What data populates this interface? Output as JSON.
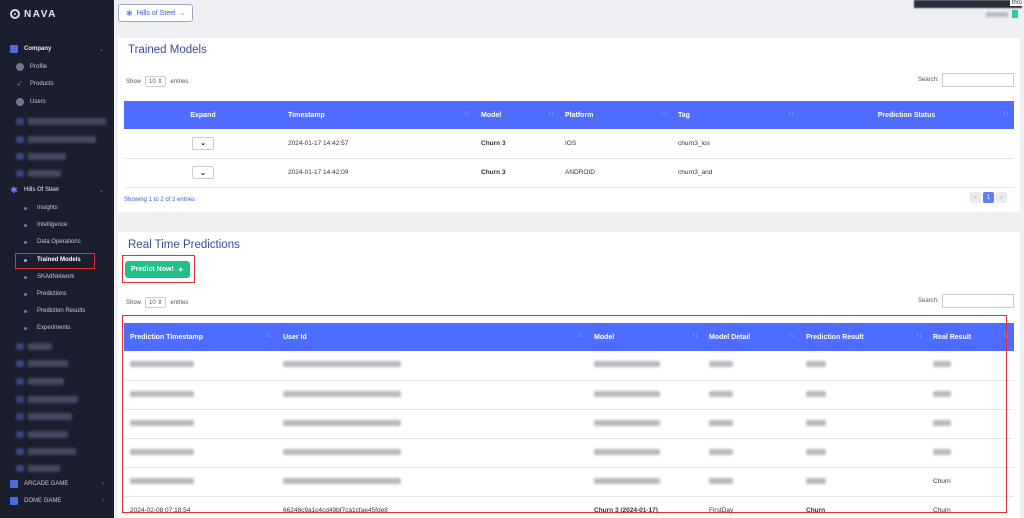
{
  "app": {
    "logo_text": "NAVA"
  },
  "sidebar": {
    "company_label": "Company",
    "profile_label": "Profile",
    "products_label": "Products",
    "users_label": "Users",
    "game_label": "Hills Of Steel",
    "game_items": [
      "Insights",
      "Intelligence",
      "Data Operations",
      "Trained Models",
      "SKAdNetwork",
      "Predictions",
      "Prediction Results",
      "Experiments"
    ],
    "arcade_label": "ARCADE GAME",
    "dome_label": "DOME GAME"
  },
  "topbar": {
    "selected_game": "Hills of Steel",
    "corner_text": "thro"
  },
  "trained_models": {
    "title": "Trained Models",
    "show_label": "Show",
    "entries_value": "10",
    "entries_label": "entries",
    "search_label": "Search:",
    "columns": [
      "Expand",
      "Timestamp",
      "Model",
      "Platform",
      "Tag",
      "Prediction Status"
    ],
    "rows": [
      {
        "timestamp": "2024-01-17 14:42:57",
        "model": "Churn 3",
        "platform": "IOS",
        "tag": "churn3_ios",
        "status": ""
      },
      {
        "timestamp": "2024-01-17 14:42:09",
        "model": "Churn 3",
        "platform": "ANDROID",
        "tag": "churn3_and",
        "status": ""
      }
    ],
    "showing_text": "Showing 1 to 2 of 2 entries",
    "page_current": "1",
    "page_prev": "‹",
    "page_next": "›"
  },
  "predictions": {
    "title": "Real Time Predictions",
    "predict_button": "Predict Now!",
    "show_label": "Show",
    "entries_value": "10",
    "entries_label": "entries",
    "search_label": "Search:",
    "columns": [
      "Prediction Timestamp",
      "User Id",
      "Model",
      "Model Detail",
      "Prediction Result",
      "Real Result"
    ],
    "visible_rows": [
      {
        "real_result": "Churn"
      },
      {
        "timestamp": "2024-02-08 07:18:54",
        "user_id": "66248c9a1c4cd49bf7ca1cfae45fde8",
        "model": "Churn 3 (2024-01-17)",
        "detail": "FirstDay",
        "prediction": "Churn",
        "real_result": "Churn"
      }
    ]
  },
  "colors": {
    "sidebar_bg": "#1b1e2d",
    "table_header": "#4e6cff",
    "accent_green": "#21c08b",
    "highlight_red": "#e03030",
    "title_blue": "#3a4a9c"
  },
  "icons": [
    "logo-mark-icon",
    "building-icon",
    "user-icon",
    "rocket-icon",
    "users-icon",
    "gear-icon",
    "chevron-down-icon",
    "sort-icon",
    "wand-icon"
  ]
}
